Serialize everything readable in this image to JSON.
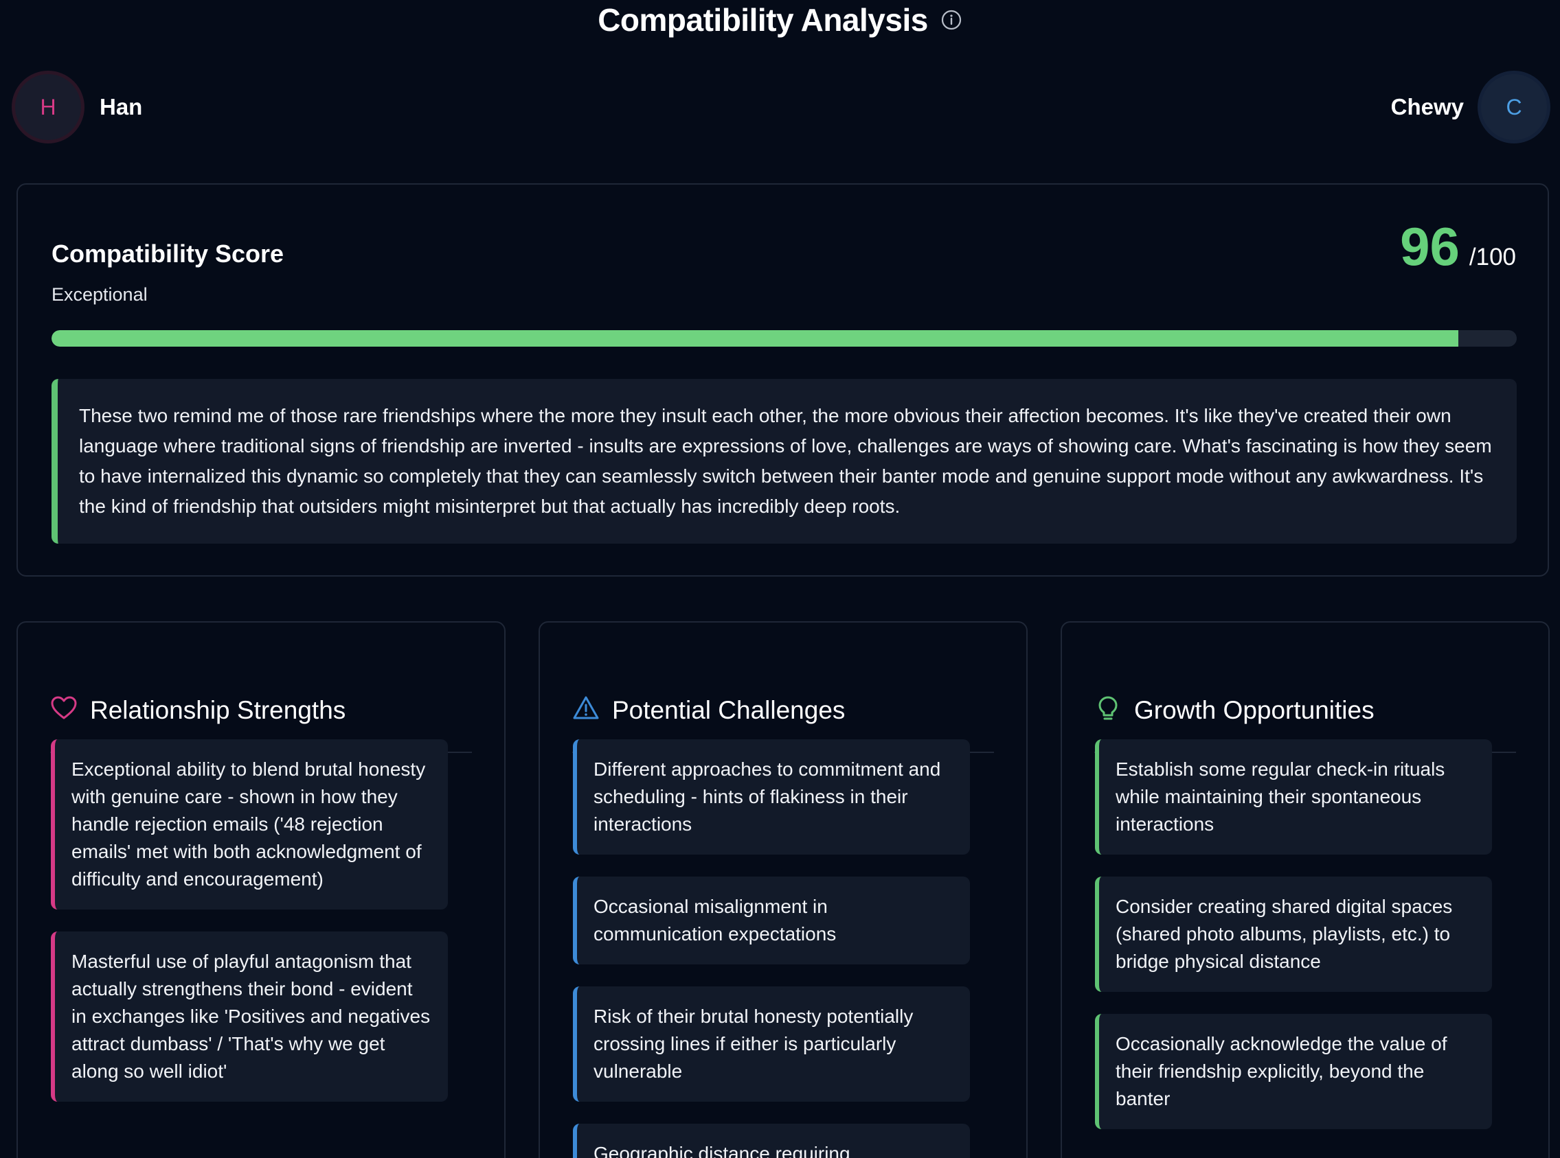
{
  "header": {
    "title": "Compatibility Analysis",
    "info_icon": "info-icon"
  },
  "people": {
    "left": {
      "initial": "H",
      "name": "Han",
      "color": "#d63a86"
    },
    "right": {
      "initial": "C",
      "name": "Chewy",
      "color": "#4d9fe4"
    }
  },
  "score": {
    "title": "Compatibility Score",
    "label": "Exceptional",
    "value": "96",
    "max": "/100",
    "progress_fraction": 0.96,
    "accent_color": "#66d17b",
    "summary": "These two remind me of those rare friendships where the more they insult each other, the more obvious their affection becomes. It's like they've created their own language where traditional signs of friendship are inverted - insults are expressions of love, challenges are ways of showing care. What's fascinating is how they seem to have internalized this dynamic so completely that they can seamlessly switch between their banter mode and genuine support mode without any awkwardness. It's the kind of friendship that outsiders might misinterpret but that actually has incredibly deep roots."
  },
  "columns": {
    "strengths": {
      "title": "Relationship Strengths",
      "icon": "heart-icon",
      "color": "#d63a86",
      "items": [
        "Exceptional ability to blend brutal honesty with genuine care - shown in how they handle rejection emails ('48 rejection emails' met with both acknowledgment of difficulty and encouragement)",
        "Masterful use of playful antagonism that actually strengthens their bond - evident in exchanges like 'Positives and negatives attract dumbass' / 'That's why we get along so well idiot'"
      ]
    },
    "challenges": {
      "title": "Potential Challenges",
      "icon": "warning-triangle-icon",
      "color": "#3d8bd8",
      "items": [
        "Different approaches to commitment and scheduling - hints of flakiness in their interactions",
        "Occasional misalignment in communication expectations",
        "Risk of their brutal honesty potentially crossing lines if either is particularly vulnerable",
        "Geographic distance requiring"
      ]
    },
    "growth": {
      "title": "Growth Opportunities",
      "icon": "lightbulb-icon",
      "color": "#5fc373",
      "items": [
        "Establish some regular check-in rituals while maintaining their spontaneous interactions",
        "Consider creating shared digital spaces (shared photo albums, playlists, etc.) to bridge physical distance",
        "Occasionally acknowledge the value of their friendship explicitly, beyond the banter"
      ]
    }
  }
}
